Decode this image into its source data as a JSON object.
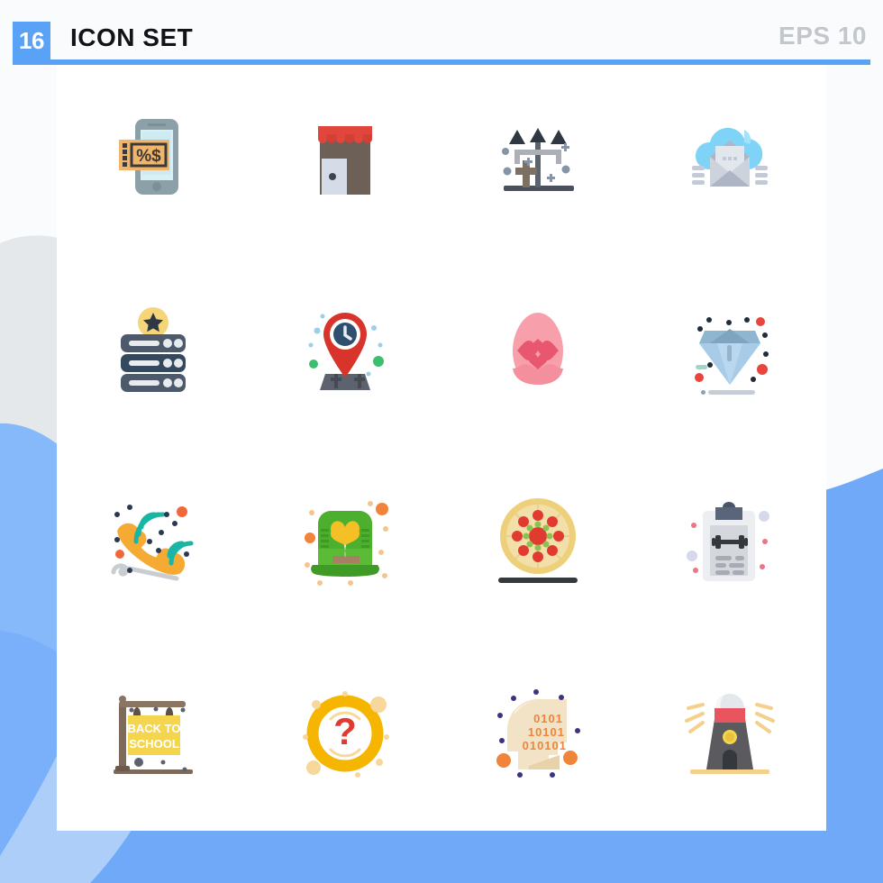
{
  "header": {
    "count_badge": "16",
    "title": "ICON SET",
    "eps_label": "EPS 10",
    "badge_color": "#5aa2f5",
    "rule_color": "#5aa2f5",
    "title_color": "#111317",
    "eps_color": "#c3c7cc"
  },
  "background": {
    "page_color": "#fafbfc",
    "card_color": "#ffffff",
    "wave_blue": "#6fa9f7",
    "wave_blue_light": "#86b9fa",
    "wave_grey": "#e4e8ea"
  },
  "grid": {
    "columns": 4,
    "rows": 4,
    "total_icons": 16
  },
  "icons": [
    {
      "index": 1,
      "name": "mobile-discount-coupon-icon",
      "label": "Mobile Discount Coupon",
      "row": 1,
      "column": 1,
      "symbols": [
        "%",
        "$"
      ],
      "colors": [
        "#8ca0a8",
        "#cfe9ef",
        "#f0b46a",
        "#3f3f3f"
      ]
    },
    {
      "index": 2,
      "name": "shop-storefront-icon",
      "label": "Shop Storefront",
      "row": 1,
      "column": 2,
      "colors": [
        "#e0463c",
        "#6d6157",
        "#d6dbe8"
      ]
    },
    {
      "index": 3,
      "name": "graveyard-arrows-icon",
      "label": "Graveyard Signpost Arrows",
      "row": 1,
      "column": 3,
      "colors": [
        "#5c636e",
        "#aab0b6",
        "#7d6f62"
      ]
    },
    {
      "index": 4,
      "name": "cloud-mail-icon",
      "label": "Cloud Mail",
      "row": 1,
      "column": 4,
      "colors": [
        "#7fd3f7",
        "#aeb6c6",
        "#dfe3ea"
      ]
    },
    {
      "index": 5,
      "name": "favorite-server-icon",
      "label": "Favorite Server",
      "row": 2,
      "column": 1,
      "colors": [
        "#4d5a6b",
        "#34495e",
        "#f5d57a"
      ]
    },
    {
      "index": 6,
      "name": "location-clock-pin-icon",
      "label": "Location Pin With Clock",
      "row": 2,
      "column": 2,
      "colors": [
        "#d8342b",
        "#2e4f6e",
        "#5c636e",
        "#3dbd6e"
      ]
    },
    {
      "index": 7,
      "name": "easter-egg-hearts-icon",
      "label": "Easter Egg With Hearts",
      "row": 2,
      "column": 3,
      "colors": [
        "#f7a0ab",
        "#e8566f"
      ]
    },
    {
      "index": 8,
      "name": "diamond-icon",
      "label": "Diamond Gem",
      "row": 2,
      "column": 4,
      "colors": [
        "#a8cbe8",
        "#7ea4bf",
        "#c7dcee",
        "#e8453c",
        "#232c3b"
      ]
    },
    {
      "index": 9,
      "name": "phone-ringing-icon",
      "label": "Phone Ringing Call",
      "row": 3,
      "column": 1,
      "colors": [
        "#f5ab33",
        "#19b5a5",
        "#f0683a",
        "#c9ccd1"
      ]
    },
    {
      "index": 10,
      "name": "leprechaun-hat-clover-icon",
      "label": "Leprechaun Hat With Clover",
      "row": 3,
      "column": 2,
      "colors": [
        "#4caf2e",
        "#66bb38",
        "#f5c026",
        "#f0843a"
      ]
    },
    {
      "index": 11,
      "name": "pizza-icon",
      "label": "Pizza",
      "row": 3,
      "column": 3,
      "colors": [
        "#efd07a",
        "#f2dfa9",
        "#e03b2e",
        "#8cc152",
        "#35383d"
      ]
    },
    {
      "index": 12,
      "name": "workout-clipboard-icon",
      "label": "Workout Clipboard",
      "row": 3,
      "column": 4,
      "colors": [
        "#e8eaed",
        "#5a657a",
        "#b8bcc4",
        "#35383d"
      ]
    },
    {
      "index": 13,
      "name": "back-to-school-sign-icon",
      "label": "Back To School Sign",
      "row": 4,
      "column": 1,
      "sign_text_line1": "BACK TO",
      "sign_text_line2": "SCHOOL",
      "colors": [
        "#f5d54e",
        "#7d6a5b",
        "#5c636e",
        "#ffffff"
      ]
    },
    {
      "index": 14,
      "name": "question-mark-help-icon",
      "label": "Question Mark Help",
      "row": 4,
      "column": 2,
      "symbol": "?",
      "colors": [
        "#f5b500",
        "#e03b2e",
        "#f7d99a"
      ]
    },
    {
      "index": 15,
      "name": "binary-head-icon",
      "label": "Binary Code Head",
      "row": 4,
      "column": 3,
      "binary_line1": "0101",
      "binary_line2": "10101",
      "binary_line3": "010101",
      "colors": [
        "#f3e3c6",
        "#e8d2aa",
        "#f0843a",
        "#3b3480"
      ]
    },
    {
      "index": 16,
      "name": "lighthouse-icon",
      "label": "Lighthouse",
      "row": 4,
      "column": 4,
      "colors": [
        "#5a5a5f",
        "#e8555e",
        "#e4e8ed",
        "#f5d54e",
        "#35383d"
      ]
    }
  ]
}
